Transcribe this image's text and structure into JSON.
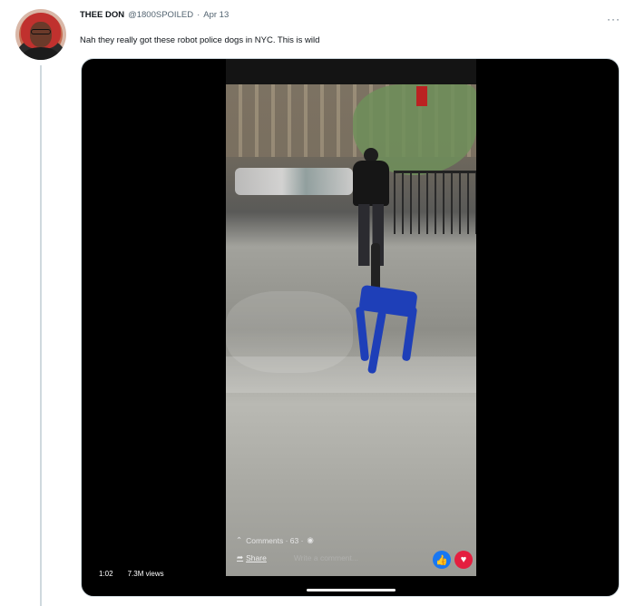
{
  "tweet": {
    "author_name": "THEE DON",
    "handle": "@1800SPOILED",
    "separator": "·",
    "date": "Apr 13",
    "text": "Nah they really got these robot police dogs in NYC. This is wild",
    "more_icon": "more-horizontal-icon"
  },
  "video": {
    "duration": "1:02",
    "views": "7.3M views",
    "overlay": {
      "comments_label": "Comments · 63 ·",
      "share_label": "Share",
      "write_placeholder": "Write a comment...",
      "like_icon": "thumbs-up-icon",
      "love_icon": "heart-icon"
    },
    "progress": 0.2
  },
  "colors": {
    "text_primary": "#0f1419",
    "text_secondary": "#536471",
    "thread_line": "#cfd9de",
    "like_blue": "#1877f2",
    "love_red": "#e41e3f"
  }
}
